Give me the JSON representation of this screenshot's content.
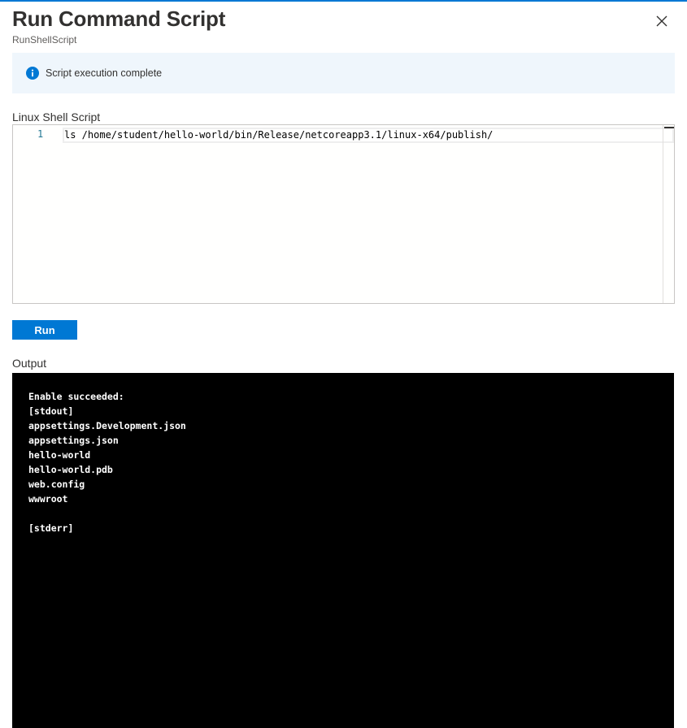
{
  "header": {
    "title": "Run Command Script",
    "subtitle": "RunShellScript",
    "close_icon": "close-icon"
  },
  "banner": {
    "icon": "info-icon",
    "text": "Script execution complete",
    "color": "#0078d4"
  },
  "editor": {
    "label": "Linux Shell Script",
    "lines": [
      {
        "number": "1",
        "code": "ls /home/student/hello-world/bin/Release/netcoreapp3.1/linux-x64/publish/"
      }
    ]
  },
  "run_button": {
    "label": "Run",
    "color": "#0078d4"
  },
  "output": {
    "label": "Output",
    "lines": [
      "Enable succeeded:",
      "[stdout]",
      "appsettings.Development.json",
      "appsettings.json",
      "hello-world",
      "hello-world.pdb",
      "web.config",
      "wwwroot",
      "",
      "[stderr]"
    ]
  }
}
